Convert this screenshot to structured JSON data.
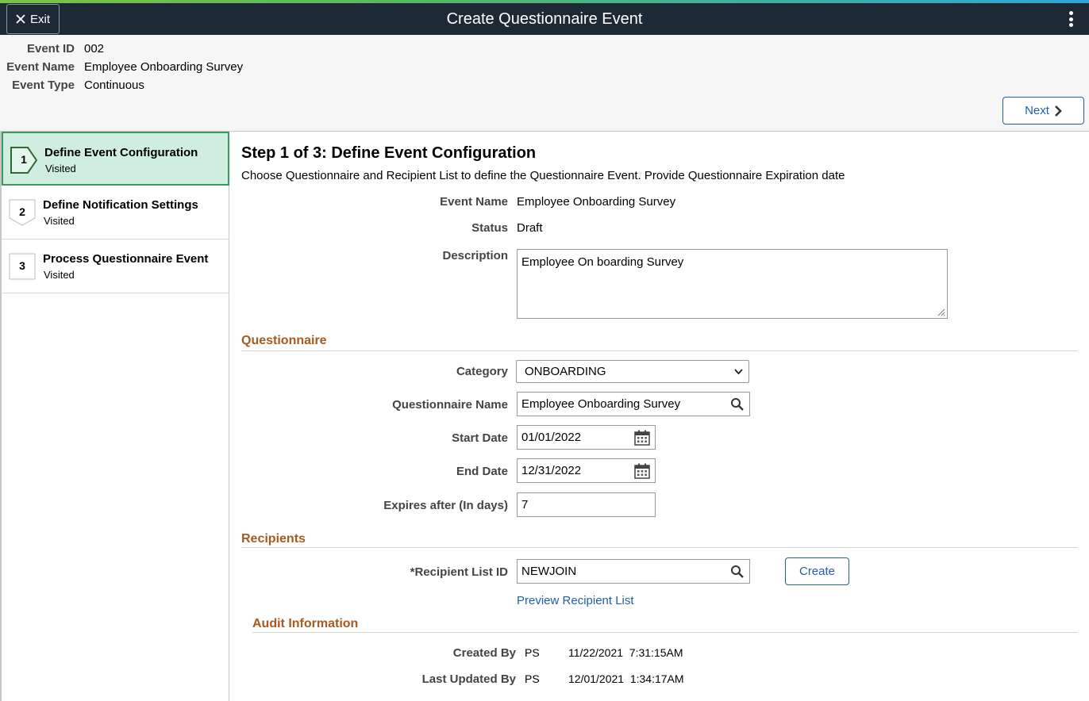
{
  "banner": {
    "exit_label": "Exit",
    "title": "Create Questionnaire Event"
  },
  "header": {
    "rows": [
      {
        "label": "Event ID",
        "value": "002"
      },
      {
        "label": "Event Name",
        "value": "Employee Onboarding Survey"
      },
      {
        "label": "Event Type",
        "value": "Continuous"
      }
    ],
    "next_label": "Next"
  },
  "steps": [
    {
      "number": "1",
      "title": "Define Event Configuration",
      "status": "Visited"
    },
    {
      "number": "2",
      "title": "Define Notification Settings",
      "status": "Visited"
    },
    {
      "number": "3",
      "title": "Process Questionnaire Event",
      "status": "Visited"
    }
  ],
  "main": {
    "title": "Step 1 of 3: Define Event Configuration",
    "description": "Choose Questionnaire and Recipient List to define the Questionnaire Event. Provide Questionnaire Expiration date",
    "event_name_label": "Event Name",
    "event_name_value": "Employee Onboarding Survey",
    "status_label": "Status",
    "status_value": "Draft",
    "description_label": "Description",
    "description_value": "Employee On boarding Survey"
  },
  "questionnaire": {
    "heading": "Questionnaire",
    "category_label": "Category",
    "category_value": "ONBOARDING",
    "name_label": "Questionnaire Name",
    "name_value": "Employee Onboarding Survey",
    "start_label": "Start Date",
    "start_value": "01/01/2022",
    "end_label": "End Date",
    "end_value": "12/31/2022",
    "expires_label": "Expires after (In days)",
    "expires_value": "7"
  },
  "recipients": {
    "heading": "Recipients",
    "list_label": "*Recipient List ID",
    "list_value": "NEWJOIN",
    "create_label": "Create",
    "preview_link": "Preview Recipient List"
  },
  "audit": {
    "heading": "Audit Information",
    "created_label": "Created By",
    "created_user": "PS",
    "created_time": "11/22/2021  7:31:15AM",
    "updated_label": "Last Updated By",
    "updated_user": "PS",
    "updated_time": "12/01/2021  1:34:17AM"
  },
  "colors": {
    "banner": "#1d2a36",
    "accent": "#1f5fa8",
    "section": "#a55a1f",
    "active_step": "#cfeee0"
  }
}
